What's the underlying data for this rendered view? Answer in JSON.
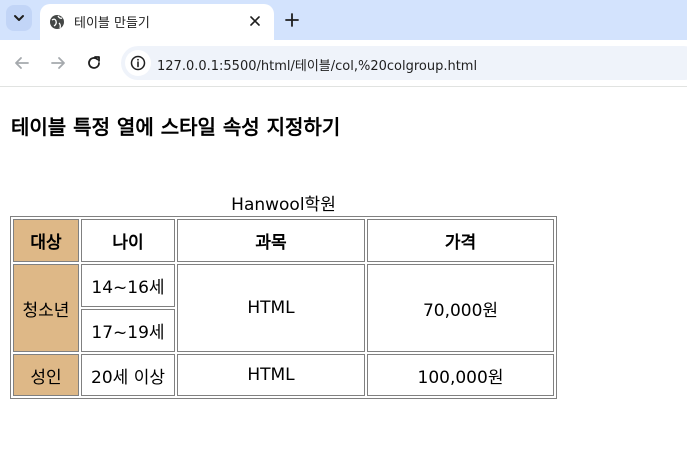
{
  "browser": {
    "tab_title": "테이블 만들기",
    "url": "127.0.0.1:5500/html/테이블/col,%20colgroup.html"
  },
  "icons": {
    "tab_search": "chevron-down-icon",
    "favicon": "globe-icon",
    "tab_close": "close-icon",
    "new_tab": "plus-icon",
    "back": "arrow-left-icon",
    "forward": "arrow-right-icon",
    "reload": "reload-icon",
    "site_info": "info-icon"
  },
  "colors": {
    "tabstrip_bg": "#d3e3fd",
    "first_column_bg": "#deb887"
  },
  "page": {
    "heading": "테이블 특정 열에 스타일 속성 지정하기",
    "table": {
      "caption": "Hanwool학원",
      "headers": [
        "대상",
        "나이",
        "과목",
        "가격"
      ],
      "rows": {
        "youth_label": "청소년",
        "youth_age_1": "14~16세",
        "youth_age_2": "17~19세",
        "youth_subject": "HTML",
        "youth_price": "70,000원",
        "adult_label": "성인",
        "adult_age": "20세 이상",
        "adult_subject": "HTML",
        "adult_price": "100,000원"
      }
    }
  }
}
